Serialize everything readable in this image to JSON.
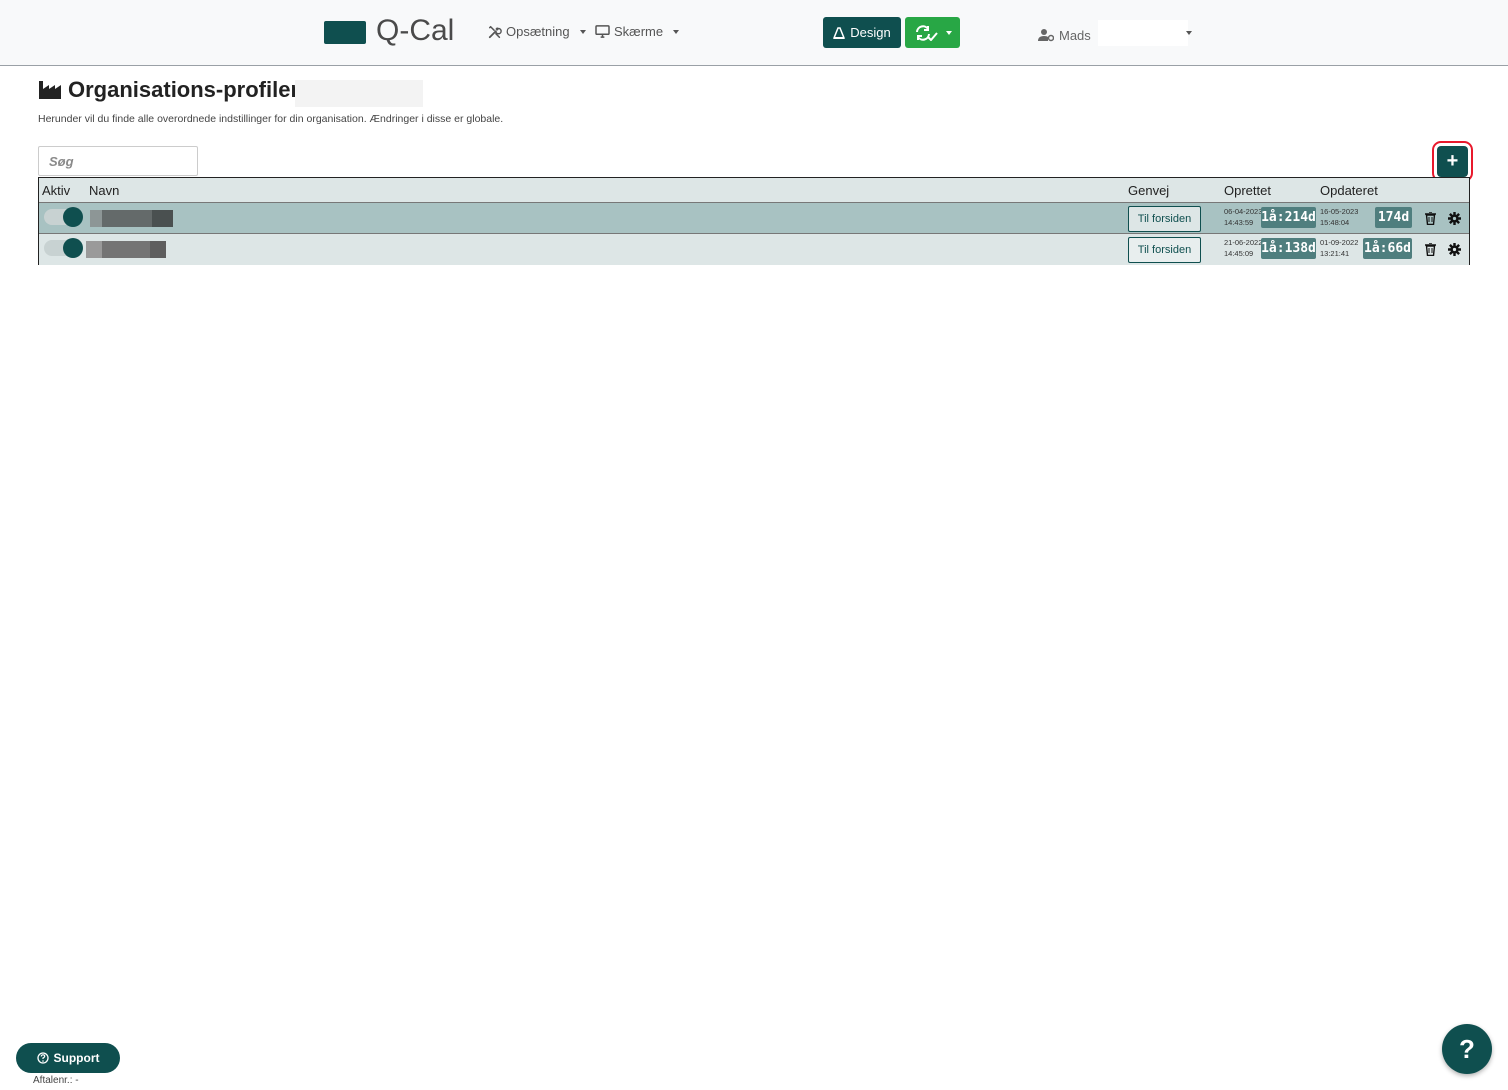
{
  "app": {
    "name": "Q-Cal"
  },
  "navbar": {
    "menu": [
      {
        "label": "Opsætning",
        "icon": "tools-icon"
      },
      {
        "label": "Skærme",
        "icon": "monitor-icon"
      }
    ],
    "design_label": "Design",
    "sync_icon": "sync-check-icon",
    "user_name": "Mads"
  },
  "page": {
    "title": "Organisations-profiler:",
    "title_icon": "factory-icon",
    "description": "Herunder vil du finde alle overordnede indstillinger for din organisation. Ændringer i disse er globale."
  },
  "search": {
    "placeholder": "Søg",
    "value": ""
  },
  "add_button": {
    "label": "+"
  },
  "table": {
    "columns": [
      "Aktiv",
      "Navn",
      "Genvej",
      "Oprettet",
      "Opdateret"
    ],
    "rows": [
      {
        "active": true,
        "name": "",
        "shortcut_label": "Til forsiden",
        "created_date": "06-04-2023",
        "created_time": "14:43:59",
        "created_age": "1å:214d",
        "updated_date": "16-05-2023",
        "updated_time": "15:48:04",
        "updated_age": "174d"
      },
      {
        "active": true,
        "name": "",
        "shortcut_label": "Til forsiden",
        "created_date": "21-06-2022",
        "created_time": "14:45:09",
        "created_age": "1å:138d",
        "updated_date": "01-09-2022",
        "updated_time": "13:21:41",
        "updated_age": "1å:66d"
      }
    ]
  },
  "footer": {
    "support_label": "Support",
    "agreement_label": "Aftalenr.: -",
    "help_label": "?"
  },
  "colors": {
    "primary": "#0f4f4f",
    "success": "#28a745",
    "row_highlight": "#a8c2c2",
    "row_default": "#dde6e6",
    "badge": "#4f7e7e",
    "focus_ring": "#e8192c"
  }
}
